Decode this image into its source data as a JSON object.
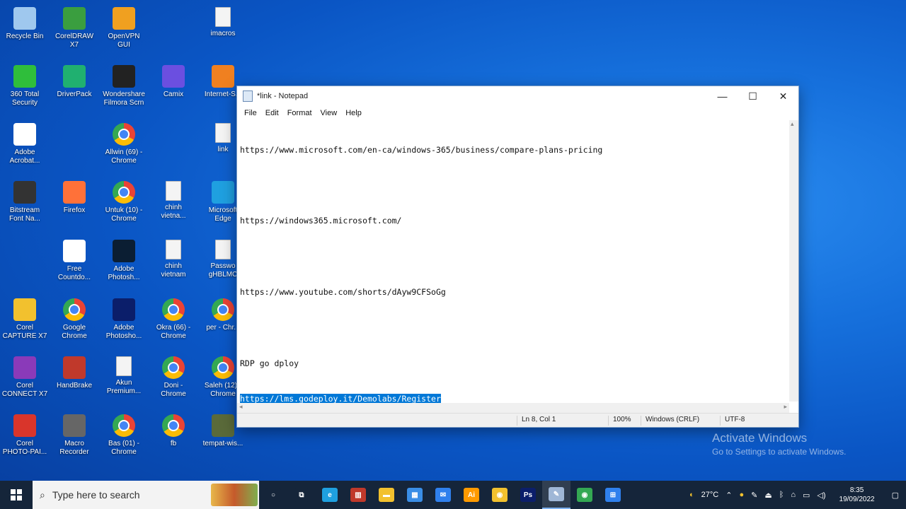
{
  "desktop": {
    "icons": [
      {
        "label": "Recycle Bin",
        "icon": "recycle-bin-icon",
        "color": "#9fc8ee"
      },
      {
        "label": "CorelDRAW\nX7",
        "icon": "coreldraw-icon",
        "color": "#3a9e3f"
      },
      {
        "label": "OpenVPN\nGUI",
        "icon": "openvpn-icon",
        "color": "#f0a020"
      },
      {
        "label": "imacros",
        "icon": "document-icon",
        "color": "#ffffff"
      },
      {
        "label": "360 Total\nSecurity",
        "icon": "360-security-icon",
        "color": "#2fbe3b"
      },
      {
        "label": "DriverPack",
        "icon": "driverpack-icon",
        "color": "#20b070"
      },
      {
        "label": "Wondershare\nFilmora Scrn",
        "icon": "filmora-icon",
        "color": "#222222"
      },
      {
        "label": "Camix",
        "icon": "camix-icon",
        "color": "#6b4fe0"
      },
      {
        "label": "Internet-S...",
        "icon": "internet-icon",
        "color": "#f08020"
      },
      {
        "label": "Adobe\nAcrobat...",
        "icon": "acrobat-icon",
        "color": "#ffffff"
      },
      {
        "label": "Allwin (69) -\nChrome",
        "icon": "chrome-icon",
        "color": "#4285f4"
      },
      {
        "label": "link",
        "icon": "document-icon",
        "color": "#ffffff"
      },
      {
        "label": "Bitstream\nFont Na...",
        "icon": "bitstream-icon",
        "color": "#333333"
      },
      {
        "label": "Firefox",
        "icon": "firefox-icon",
        "color": "#ff7139"
      },
      {
        "label": "Untuk (10) -\nChrome",
        "icon": "chrome-icon",
        "color": "#4285f4"
      },
      {
        "label": "chinh\nvietna...",
        "icon": "document-icon",
        "color": "#ffffff"
      },
      {
        "label": "Microsoft\nEdge",
        "icon": "edge-icon",
        "color": "#1fa0e0"
      },
      {
        "label": "Free\nCountdo...",
        "icon": "countdown-icon",
        "color": "#ffffff"
      },
      {
        "label": "Adobe\nPhotosh...",
        "icon": "photoshop-icon",
        "color": "#0b1e33"
      },
      {
        "label": "chinh\nvietnam",
        "icon": "document-icon",
        "color": "#ffffff"
      },
      {
        "label": "Passwo\ngHBLMC",
        "icon": "document-icon",
        "color": "#ffffff"
      },
      {
        "label": "Corel\nCAPTURE X7",
        "icon": "corel-capture-icon",
        "color": "#f2c12e"
      },
      {
        "label": "Google\nChrome",
        "icon": "chrome-icon",
        "color": "#4285f4"
      },
      {
        "label": "Adobe\nPhotosho...",
        "icon": "photoshop-icon",
        "color": "#0b1e6a"
      },
      {
        "label": "Okra (66) -\nChrome",
        "icon": "chrome-icon",
        "color": "#4285f4"
      },
      {
        "label": "per - Chr...",
        "icon": "chrome-icon",
        "color": "#4285f4"
      },
      {
        "label": "Corel\nCONNECT X7",
        "icon": "corel-connect-icon",
        "color": "#8a3ab9"
      },
      {
        "label": "HandBrake",
        "icon": "handbrake-icon",
        "color": "#c0392b"
      },
      {
        "label": "Akun\nPremium...",
        "icon": "document-icon",
        "color": "#ffffff"
      },
      {
        "label": "Doni -\nChrome",
        "icon": "chrome-icon",
        "color": "#4285f4"
      },
      {
        "label": "Saleh (12) -\nChrome",
        "icon": "chrome-icon",
        "color": "#4285f4"
      },
      {
        "label": "Corel\nPHOTO-PAI...",
        "icon": "corel-photopaint-icon",
        "color": "#d9352b"
      },
      {
        "label": "Macro\nRecorder",
        "icon": "macro-recorder-icon",
        "color": "#666666"
      },
      {
        "label": "Bas (01) -\nChrome",
        "icon": "chrome-icon",
        "color": "#4285f4"
      },
      {
        "label": "fb",
        "icon": "chrome-icon",
        "color": "#4285f4"
      },
      {
        "label": "tempat-wis...",
        "icon": "image-icon",
        "color": "#5a6a3a"
      }
    ]
  },
  "notepad": {
    "title": "*link - Notepad",
    "menu": [
      "File",
      "Edit",
      "Format",
      "View",
      "Help"
    ],
    "lines": [
      "https://www.microsoft.com/en-ca/windows-365/business/compare-plans-pricing",
      "",
      "https://windows365.microsoft.com/",
      "",
      "https://www.youtube.com/shorts/dAyw9CFSoGg",
      "",
      "RDP go dploy",
      "https://lms.godeploy.it/Demolabs/Register"
    ],
    "status": {
      "position": "Ln 8, Col 1",
      "zoom": "100%",
      "line_ending": "Windows (CRLF)",
      "encoding": "UTF-8"
    }
  },
  "watermark": {
    "title": "Activate Windows",
    "subtitle": "Go to Settings to activate Windows."
  },
  "taskbar": {
    "search_placeholder": "Type here to search",
    "pinned": [
      {
        "name": "task-view-icon",
        "label": "○",
        "color": "#15253a"
      },
      {
        "name": "timeline-icon",
        "label": "⧉",
        "color": "#15253a"
      },
      {
        "name": "edge-icon",
        "label": "e",
        "color": "#1fa0e0"
      },
      {
        "name": "app-red-icon",
        "label": "▥",
        "color": "#c0392b"
      },
      {
        "name": "file-explorer-icon",
        "label": "▬",
        "color": "#f2c12e"
      },
      {
        "name": "store-icon",
        "label": "▦",
        "color": "#3a8ee6"
      },
      {
        "name": "mail-icon",
        "label": "✉",
        "color": "#2f80ed"
      },
      {
        "name": "illustrator-icon",
        "label": "Ai",
        "color": "#ff9a00"
      },
      {
        "name": "chrome-icon",
        "label": "◉",
        "color": "#f2c12e"
      },
      {
        "name": "photoshop-icon",
        "label": "Ps",
        "color": "#0b1e6a"
      },
      {
        "name": "notepad-icon",
        "label": "✎",
        "color": "#9fb7d6"
      },
      {
        "name": "chrome-icon-2",
        "label": "◉",
        "color": "#34a853"
      },
      {
        "name": "network-app-icon",
        "label": "⊞",
        "color": "#2f80ed"
      }
    ],
    "weather": "27°C",
    "time": "8:35",
    "date": "19/09/2022"
  }
}
